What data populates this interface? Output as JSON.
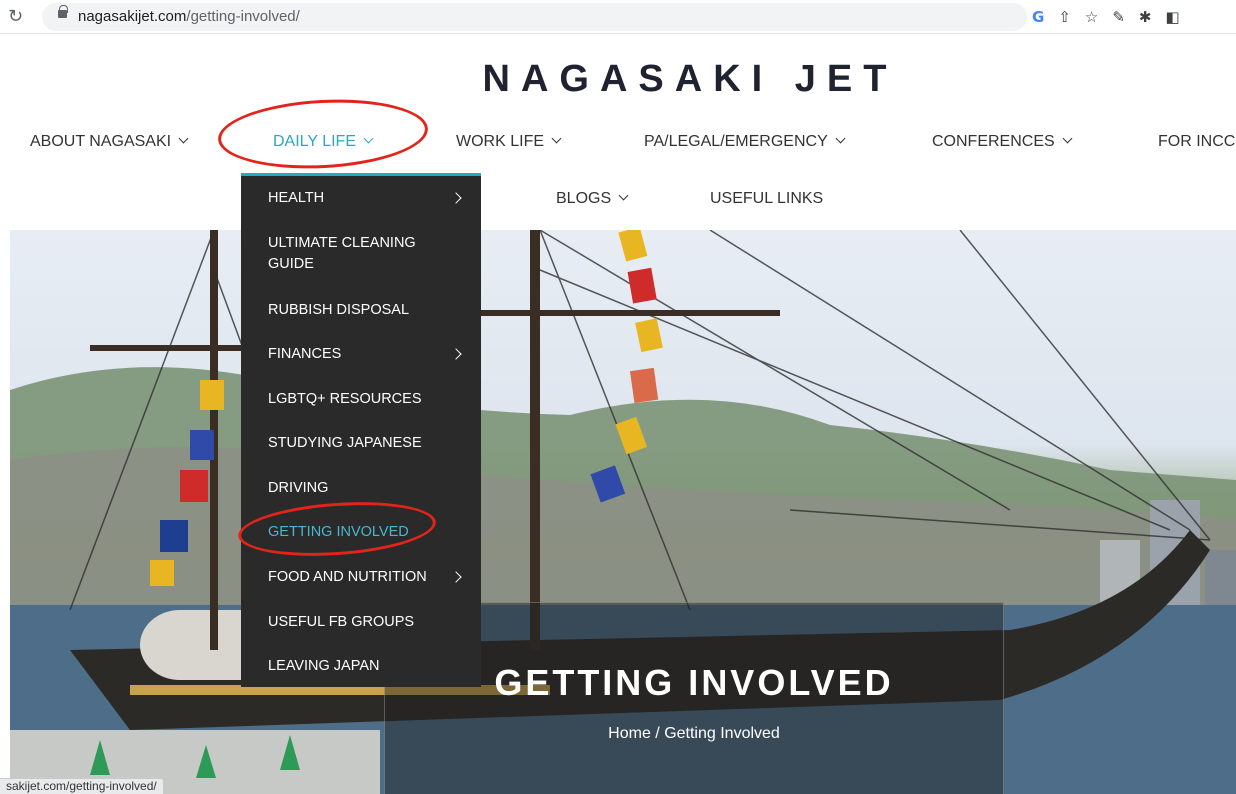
{
  "browser": {
    "url_host": "nagasakijet.com",
    "url_path": "/getting-involved/",
    "status_url": "sakijet.com/getting-involved/"
  },
  "site": {
    "title": "NAGASAKI JET"
  },
  "nav": {
    "row1": [
      "ABOUT NAGASAKI",
      "DAILY LIFE",
      "WORK LIFE",
      "PA/LEGAL/EMERGENCY",
      "CONFERENCES",
      "FOR INCC"
    ],
    "row2": [
      "BLOGS",
      "USEFUL LINKS"
    ],
    "active": "DAILY LIFE"
  },
  "dropdown": {
    "items": [
      {
        "label": "HEALTH",
        "has_submenu": true
      },
      {
        "label": "ULTIMATE CLEANING GUIDE",
        "has_submenu": false
      },
      {
        "label": "RUBBISH DISPOSAL",
        "has_submenu": false
      },
      {
        "label": "FINANCES",
        "has_submenu": true
      },
      {
        "label": "LGBTQ+ RESOURCES",
        "has_submenu": false
      },
      {
        "label": "STUDYING JAPANESE",
        "has_submenu": false
      },
      {
        "label": "DRIVING",
        "has_submenu": false
      },
      {
        "label": "GETTING INVOLVED",
        "has_submenu": false,
        "current": true
      },
      {
        "label": "FOOD AND NUTRITION",
        "has_submenu": true
      },
      {
        "label": "USEFUL FB GROUPS",
        "has_submenu": false
      },
      {
        "label": "LEAVING JAPAN",
        "has_submenu": false
      }
    ],
    "accent_color": "#2aa8c2"
  },
  "hero": {
    "title": "GETTING INVOLVED",
    "breadcrumb": "Home / Getting Involved"
  },
  "colors": {
    "accent": "#2aa8c2",
    "annotation": "#e3241a",
    "dropdown_bg": "#2a2a2a"
  }
}
